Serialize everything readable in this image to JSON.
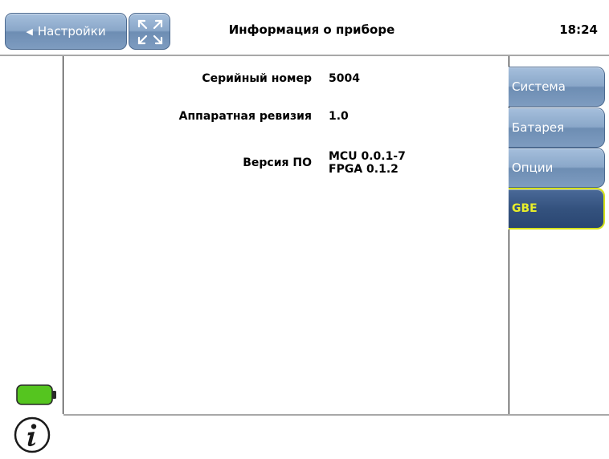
{
  "header": {
    "back_label": "Настройки",
    "title": "Информация о приборе",
    "time": "18:24"
  },
  "device_info": {
    "serial_label": "Серийный номер",
    "serial_value": "5004",
    "hw_label": "Аппаратная ревизия",
    "hw_value": "1.0",
    "sw_label": "Версия ПО",
    "sw_mcu": "MCU 0.0.1-7",
    "sw_fpga": "FPGA 0.1.2"
  },
  "tabs": [
    {
      "label": "Система"
    },
    {
      "label": "Батарея"
    },
    {
      "label": "Опции"
    },
    {
      "label": "GBE",
      "active": true
    }
  ],
  "status": {
    "battery_color": "#55c51f",
    "icons": [
      "battery-icon",
      "info-icon",
      "expand-icon"
    ]
  }
}
